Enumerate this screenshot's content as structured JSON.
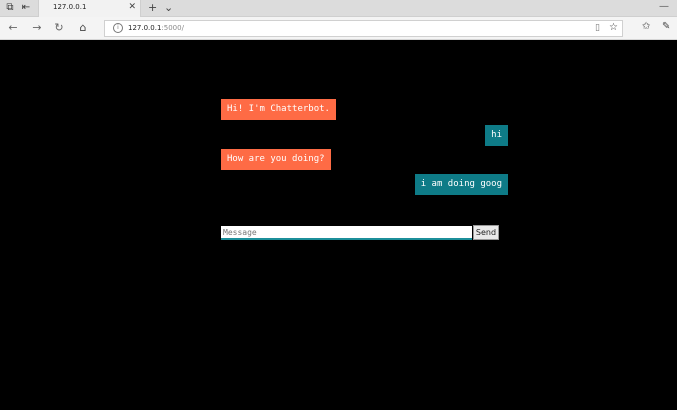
{
  "browser": {
    "tab_title": "127.0.0.1",
    "tab_close": "✕",
    "new_tab": "+",
    "tab_menu": "⌄",
    "url_host": "127.0.0.1",
    "url_rest": ":5000/"
  },
  "icons": {
    "tabs_aside": "tab-aside-icon",
    "back_tabs": "set-aside-icon",
    "back": "back-arrow-icon",
    "forward": "forward-arrow-icon",
    "refresh": "refresh-icon",
    "home": "home-icon",
    "info": "info-icon",
    "reading_view": "reading-view-icon",
    "favorite": "star-icon",
    "favorites_hub": "favorites-hub-icon",
    "pen": "pen-icon",
    "minimize": "minimize-icon"
  },
  "chat": {
    "messages": [
      {
        "sender": "bot",
        "text": "Hi! I'm Chatterbot."
      },
      {
        "sender": "user",
        "text": "hi"
      },
      {
        "sender": "bot",
        "text": "How are you doing?"
      },
      {
        "sender": "user",
        "text": "i am doing goog"
      }
    ],
    "input_placeholder": "Message",
    "input_value": "",
    "send_label": "Send"
  },
  "colors": {
    "bot_bubble": "#fe6b45",
    "user_bubble": "#0e7b87",
    "page_background": "#000000"
  }
}
